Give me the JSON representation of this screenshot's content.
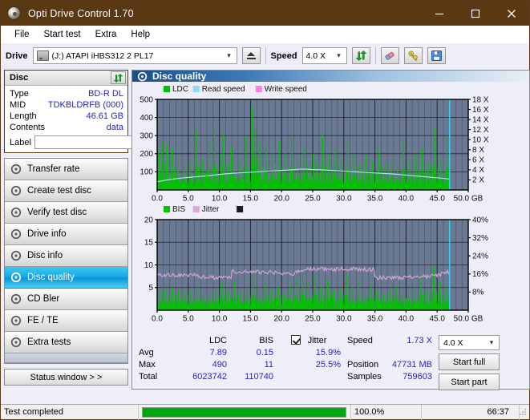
{
  "window": {
    "title": "Opti Drive Control 1.70",
    "icon": "disc-icon",
    "minimize": "minimize-icon",
    "maximize": "maximize-icon",
    "close": "close-icon"
  },
  "menu": {
    "items": [
      "File",
      "Start test",
      "Extra",
      "Help"
    ]
  },
  "toolbar": {
    "drive_label": "Drive",
    "drive_value": "(J:)   ATAPI iHBS312  2 PL17",
    "eject_icon": "eject-icon",
    "speed_label": "Speed",
    "speed_value": "4.0 X",
    "refresh_icon": "refresh-icon",
    "erase_icon": "eraser-icon",
    "tools_icon": "tools-icon",
    "save_icon": "save-floppy-icon"
  },
  "disc": {
    "header": "Disc",
    "refresh_icon": "refresh-icon",
    "rows": [
      {
        "key": "Type",
        "value": "BD-R DL"
      },
      {
        "key": "MID",
        "value": "TDKBLDRFB (000)"
      },
      {
        "key": "Length",
        "value": "46.61 GB"
      },
      {
        "key": "Contents",
        "value": "data"
      }
    ],
    "label_key": "Label",
    "label_value": "",
    "label_button_icon": "cd-icon"
  },
  "sidebar": {
    "items": [
      {
        "label": "Transfer rate",
        "selected": false
      },
      {
        "label": "Create test disc",
        "selected": false
      },
      {
        "label": "Verify test disc",
        "selected": false
      },
      {
        "label": "Drive info",
        "selected": false
      },
      {
        "label": "Disc info",
        "selected": false
      },
      {
        "label": "Disc quality",
        "selected": true
      },
      {
        "label": "CD Bler",
        "selected": false
      },
      {
        "label": "FE / TE",
        "selected": false
      },
      {
        "label": "Extra tests",
        "selected": false
      }
    ],
    "status_window": "Status window > >"
  },
  "panel": {
    "header": "Disc quality",
    "header_icon": "disc-quality-icon"
  },
  "stats": {
    "col_ldc": "LDC",
    "col_bis": "BIS",
    "jitter_label": "Jitter",
    "jitter_checked": true,
    "rows": [
      {
        "name": "Avg",
        "ldc": "7.89",
        "bis": "0.15",
        "jitter": "15.9%"
      },
      {
        "name": "Max",
        "ldc": "490",
        "bis": "11",
        "jitter": "25.5%"
      },
      {
        "name": "Total",
        "ldc": "6023742",
        "bis": "110740",
        "jitter": ""
      }
    ]
  },
  "results": {
    "speed_label": "Speed",
    "speed_value": "1.73 X",
    "position_label": "Position",
    "position_value": "47731 MB",
    "samples_label": "Samples",
    "samples_value": "759603",
    "speed_select": "4.0 X",
    "start_full": "Start full",
    "start_part": "Start part"
  },
  "statusbar": {
    "message": "Test completed",
    "percent_text": "100.0%",
    "percent_value": 100,
    "elapsed": "66:37"
  },
  "colors": {
    "title_bar": "#5a3812",
    "ldc": "#00c000",
    "read_speed": "#8fd8f5",
    "write_speed": "#ff7fe0",
    "bis": "#00c000",
    "jitter": "#d8a8d8",
    "plot_bg": "#6b7a94",
    "accent_blue": "#2424cf",
    "progress": "#00a80f"
  },
  "chart_data": [
    {
      "type": "line",
      "id": "top-chart",
      "title": "Disc quality - LDC / speed",
      "xlabel": "GB",
      "ylabel": "LDC",
      "xlim": [
        0,
        50
      ],
      "ylim": [
        0,
        500
      ],
      "y2lim": [
        0,
        18
      ],
      "y2label": "X",
      "xticks": [
        "0.0",
        "5.0",
        "10.0",
        "15.0",
        "20.0",
        "25.0",
        "30.0",
        "35.0",
        "40.0",
        "45.0",
        "50.0 GB"
      ],
      "yticks": [
        100,
        200,
        300,
        400,
        500
      ],
      "y2ticks": [
        "2 X",
        "4 X",
        "6 X",
        "8 X",
        "10 X",
        "12 X",
        "14 X",
        "16 X",
        "18 X"
      ],
      "grid": true,
      "legend_position": "top-left",
      "legend": [
        {
          "name": "LDC",
          "color": "#00c000"
        },
        {
          "name": "Read speed",
          "color": "#8fd8f5"
        },
        {
          "name": "Write speed",
          "color": "#ff7fe0"
        }
      ],
      "data_end_gb": 47.0,
      "series": [
        {
          "name": "LDC",
          "kind": "impulse",
          "color": "#00c000",
          "baseline": 30,
          "x": [
            0.3,
            0.8,
            1.3,
            1.6,
            2.0,
            2.4,
            2.9,
            3.3,
            3.8,
            4.3,
            4.8,
            5.3,
            5.8,
            6.3,
            6.8,
            7.3,
            7.8,
            8.2,
            8.7,
            9.2,
            9.7,
            10.2,
            10.6,
            11.0,
            11.4,
            11.9,
            12.3,
            12.8,
            13.3,
            13.8,
            14.3,
            14.8,
            15.3,
            15.7,
            16.1,
            16.5,
            17.0,
            17.5,
            18.0,
            18.5,
            19.0,
            19.6,
            20.1,
            20.6,
            21.1,
            21.6,
            22.1,
            22.6,
            23.1,
            23.6,
            24.1,
            24.6,
            25.1,
            25.6,
            26.1,
            26.6,
            27.1,
            27.6,
            28.1,
            28.6,
            29.1,
            29.6,
            30.1,
            30.6,
            31.1,
            31.6,
            32.1,
            32.6,
            33.1,
            33.6,
            34.1,
            34.6,
            35.1,
            35.6,
            36.1,
            36.6,
            37.1,
            37.6,
            38.1,
            38.6,
            39.1,
            39.6,
            40.1,
            40.6,
            41.1,
            41.6,
            42.1,
            42.6,
            43.1,
            43.6,
            44.1,
            44.6,
            45.1,
            45.6,
            46.1,
            46.6
          ],
          "y": [
            210,
            275,
            150,
            245,
            100,
            230,
            120,
            180,
            95,
            140,
            110,
            160,
            90,
            330,
            120,
            170,
            100,
            250,
            130,
            340,
            115,
            200,
            310,
            105,
            150,
            240,
            200,
            95,
            160,
            125,
            300,
            110,
            460,
            330,
            180,
            260,
            120,
            240,
            95,
            210,
            150,
            270,
            130,
            210,
            100,
            300,
            135,
            180,
            110,
            240,
            160,
            120,
            200,
            150,
            95,
            310,
            130,
            190,
            105,
            230,
            140,
            170,
            95,
            280,
            120,
            200,
            130,
            150,
            110,
            190,
            100,
            160,
            95,
            230,
            120,
            150,
            110,
            170,
            100,
            140,
            95,
            280,
            110,
            160,
            100,
            190,
            115,
            230,
            105,
            150,
            110,
            340,
            120,
            180,
            100,
            300
          ]
        },
        {
          "name": "Read speed",
          "kind": "line",
          "color": "#b8e6fa",
          "x": [
            0,
            2,
            4,
            6,
            8,
            10,
            12,
            14,
            16,
            18,
            20,
            22,
            23,
            24,
            25,
            26,
            28,
            30,
            32,
            34,
            36,
            38,
            40,
            42,
            44,
            46,
            47
          ],
          "y": [
            45,
            58,
            66,
            72,
            78,
            86,
            92,
            96,
            100,
            104,
            108,
            112,
            115,
            115,
            112,
            112,
            108,
            104,
            100,
            96,
            92,
            88,
            82,
            76,
            70,
            64,
            60
          ]
        }
      ]
    },
    {
      "type": "line",
      "id": "bottom-chart",
      "title": "Disc quality - BIS / jitter",
      "xlabel": "GB",
      "ylabel": "BIS",
      "xlim": [
        0,
        50
      ],
      "ylim": [
        0,
        20
      ],
      "y2lim": [
        0,
        40
      ],
      "y2label": "%",
      "xticks": [
        "0.0",
        "5.0",
        "10.0",
        "15.0",
        "20.0",
        "25.0",
        "30.0",
        "35.0",
        "40.0",
        "45.0",
        "50.0 GB"
      ],
      "yticks": [
        5,
        10,
        15,
        20
      ],
      "y2ticks": [
        "8%",
        "16%",
        "24%",
        "32%",
        "40%"
      ],
      "grid": true,
      "legend_position": "top-left",
      "legend": [
        {
          "name": "BIS",
          "color": "#00c000"
        },
        {
          "name": "Jitter",
          "color": "#d8a8d8"
        },
        {
          "name": "",
          "color": "#1a1a28"
        }
      ],
      "data_end_gb": 47.0,
      "series": [
        {
          "name": "BIS",
          "kind": "impulse",
          "color": "#00c000",
          "baseline": 1.6,
          "x": [
            0.4,
            0.9,
            1.4,
            1.9,
            2.4,
            2.9,
            3.4,
            3.9,
            4.4,
            4.9,
            5.4,
            5.9,
            6.4,
            6.9,
            7.4,
            7.9,
            8.4,
            8.9,
            9.4,
            9.9,
            10.4,
            10.9,
            11.4,
            11.9,
            12.4,
            12.9,
            13.4,
            13.9,
            14.4,
            14.9,
            15.4,
            15.9,
            16.4,
            16.9,
            17.4,
            17.9,
            18.4,
            18.9,
            19.4,
            19.9,
            20.4,
            20.9,
            21.4,
            21.9,
            22.4,
            22.9,
            23.4,
            23.9,
            24.4,
            24.9,
            25.4,
            25.9,
            26.4,
            26.9,
            27.4,
            27.9,
            28.4,
            28.9,
            29.4,
            29.9,
            30.4,
            30.9,
            31.4,
            31.9,
            32.4,
            32.9,
            33.4,
            33.9,
            34.4,
            34.9,
            35.4,
            35.9,
            36.4,
            36.9,
            37.4,
            37.9,
            38.4,
            38.9,
            39.4,
            39.9,
            40.4,
            40.9,
            41.4,
            41.9,
            42.4,
            42.9,
            43.4,
            43.9,
            44.4,
            44.9,
            45.4,
            45.9,
            46.4,
            46.8
          ],
          "y": [
            3.0,
            5.0,
            4.2,
            3.2,
            5.0,
            3.5,
            4.6,
            2.8,
            4.0,
            3.2,
            4.4,
            2.6,
            5.5,
            3.0,
            4.0,
            2.8,
            3.6,
            2.6,
            4.2,
            3.0,
            6.0,
            3.4,
            4.4,
            2.8,
            6.5,
            3.6,
            4.2,
            2.9,
            5.2,
            3.2,
            7.8,
            4.0,
            5.0,
            3.2,
            6.0,
            3.4,
            4.6,
            2.8,
            5.2,
            3.0,
            4.0,
            2.6,
            5.6,
            3.2,
            7.0,
            4.0,
            9.0,
            5.0,
            6.2,
            3.6,
            8.0,
            4.2,
            5.4,
            3.0,
            6.6,
            3.8,
            4.6,
            2.8,
            5.0,
            3.2,
            8.5,
            4.4,
            5.2,
            3.0,
            6.0,
            3.4,
            4.2,
            2.8,
            5.6,
            3.2,
            4.4,
            2.6,
            3.8,
            2.8,
            4.6,
            3.0,
            5.4,
            3.2,
            4.0,
            2.6,
            3.6,
            2.8,
            5.0,
            3.0,
            8.0,
            3.6,
            4.4,
            2.8,
            9.5,
            4.0,
            6.2,
            3.4,
            5.0,
            3.0
          ]
        },
        {
          "name": "Jitter",
          "kind": "line",
          "color": "#d8a8d8",
          "x": [
            0,
            1,
            2,
            3,
            4,
            5,
            6,
            7,
            8,
            9,
            10,
            11,
            11.9,
            12,
            13,
            14,
            15,
            16,
            17,
            18,
            19,
            20,
            21,
            22,
            23,
            24,
            25,
            26,
            27,
            28,
            29,
            30,
            31,
            32,
            33,
            34,
            34.9,
            35,
            36,
            37,
            38,
            39,
            40,
            41,
            42,
            43,
            44,
            45,
            46,
            47
          ],
          "y": [
            8.0,
            7.8,
            7.9,
            7.8,
            7.9,
            7.8,
            7.7,
            7.4,
            7.3,
            7.2,
            7.3,
            7.2,
            7.2,
            8.6,
            8.5,
            8.6,
            8.5,
            8.4,
            8.5,
            8.4,
            8.3,
            8.2,
            8.1,
            8.0,
            8.6,
            9.0,
            9.0,
            9.1,
            9.0,
            9.1,
            9.0,
            9.1,
            9.0,
            9.1,
            9.0,
            9.0,
            9.0,
            7.2,
            7.2,
            7.1,
            7.2,
            7.1,
            7.2,
            7.3,
            7.3,
            7.4,
            7.5,
            7.6,
            8.2,
            8.4
          ]
        }
      ]
    }
  ]
}
